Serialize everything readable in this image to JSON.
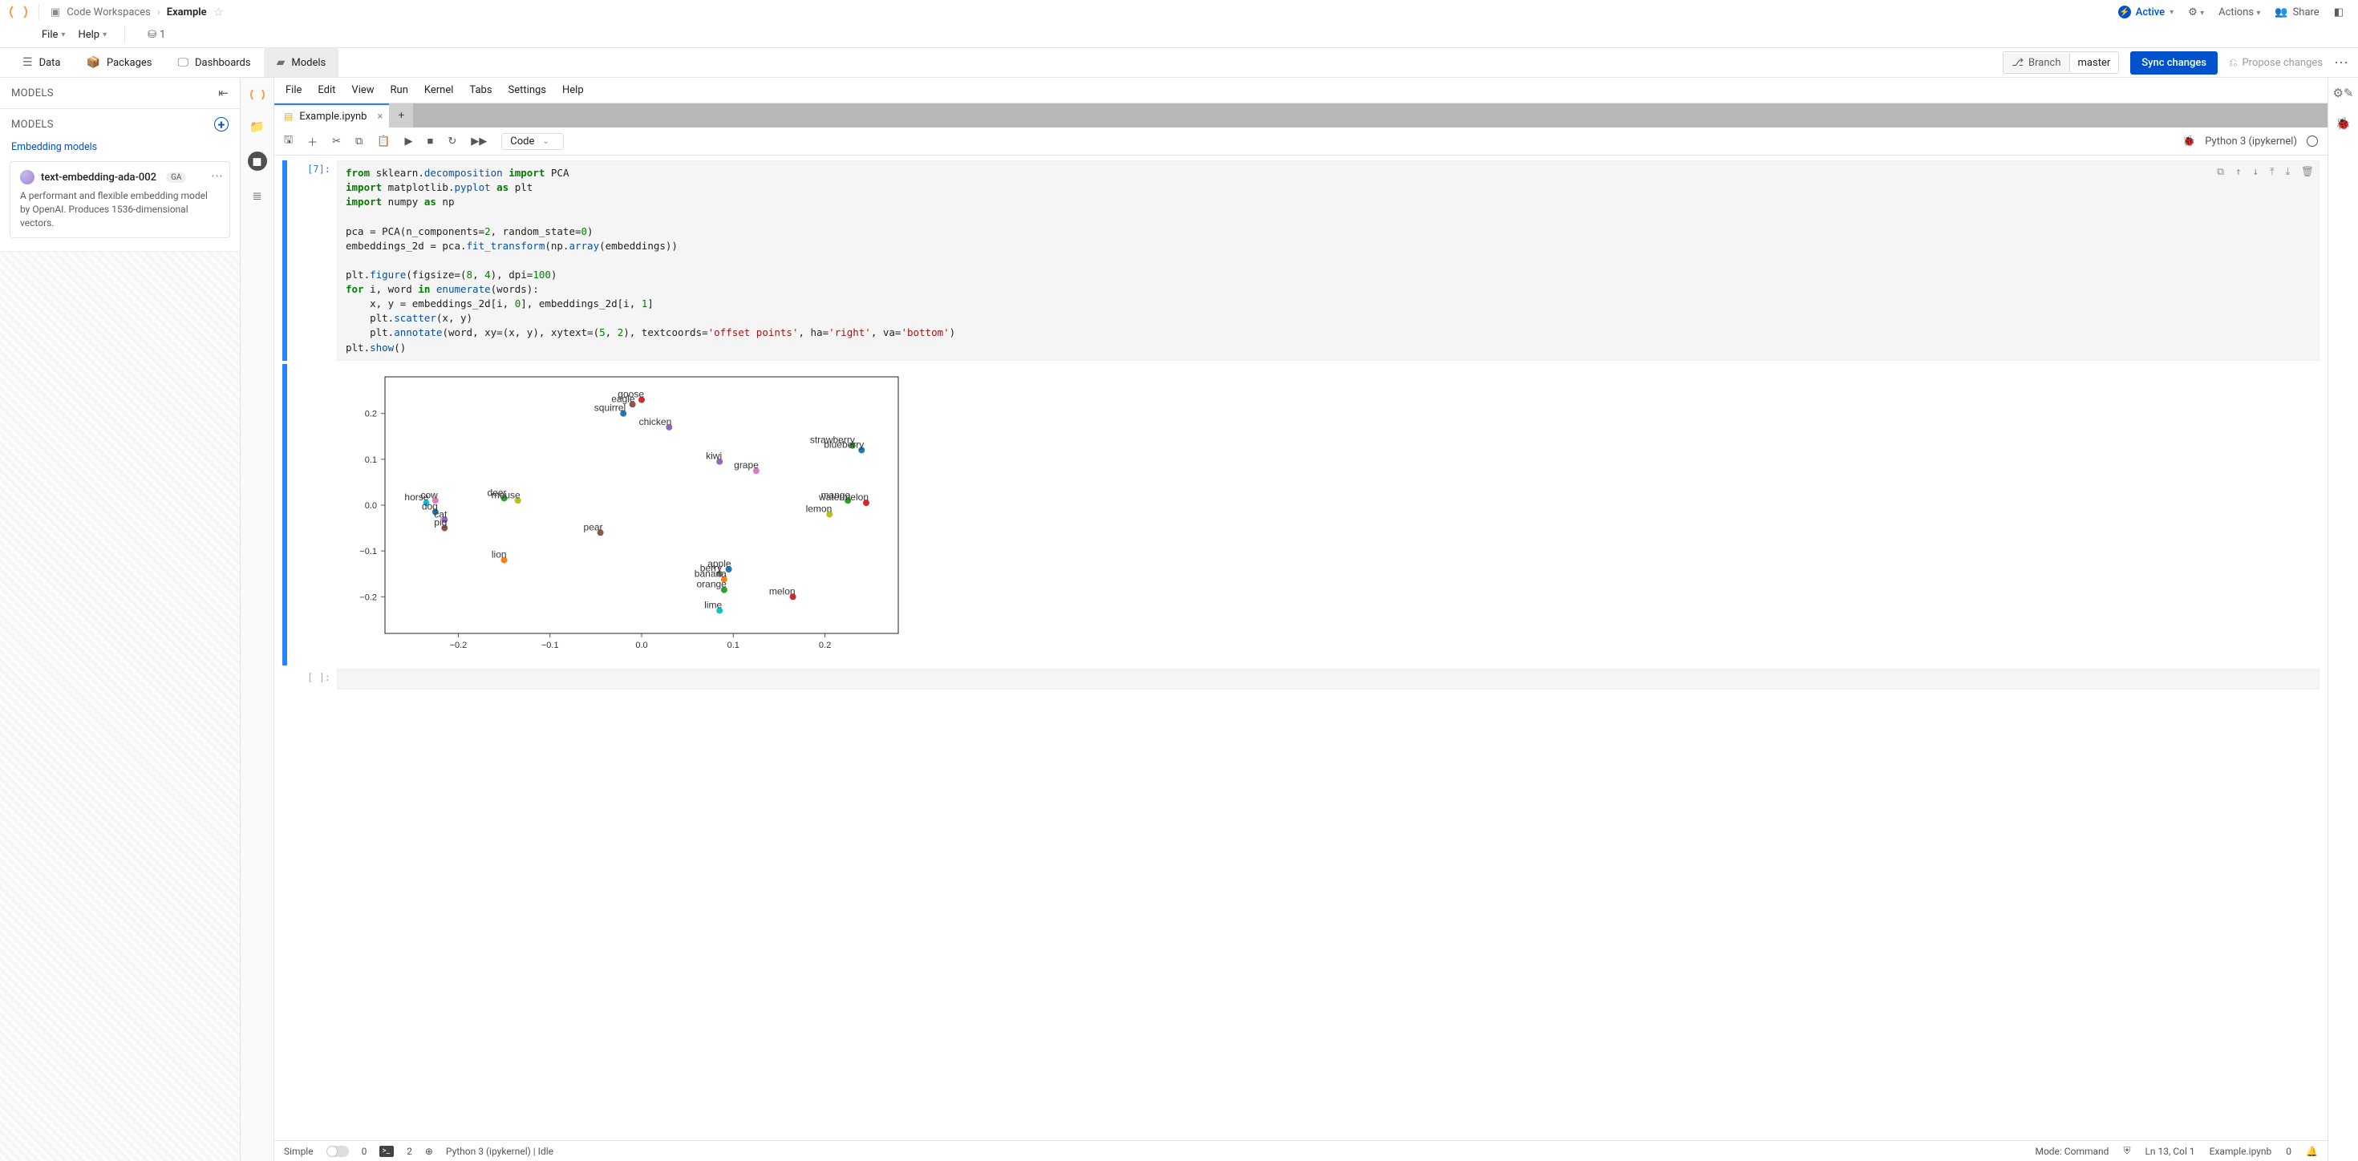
{
  "breadcrumbs": {
    "root": "Code Workspaces",
    "current": "Example"
  },
  "file_menu": {
    "file": "File",
    "help": "Help"
  },
  "resource_count": "1",
  "header_right": {
    "status": "Active",
    "actions": "Actions",
    "share": "Share"
  },
  "ctx_tabs": {
    "data": "Data",
    "packages": "Packages",
    "dashboards": "Dashboards",
    "models": "Models"
  },
  "branch": {
    "label": "Branch",
    "name": "master"
  },
  "buttons": {
    "sync": "Sync changes",
    "propose": "Propose changes"
  },
  "left_panel": {
    "title": "MODELS",
    "subtitle": "MODELS",
    "group": "Embedding models",
    "card": {
      "name": "text-embedding-ada-002",
      "badge": "GA",
      "desc": "A performant and flexible embedding model by OpenAI. Produces 1536-dimensional vectors."
    }
  },
  "nb_menus": {
    "file": "File",
    "edit": "Edit",
    "view": "View",
    "run": "Run",
    "kernel": "Kernel",
    "tabs": "Tabs",
    "settings": "Settings",
    "help": "Help"
  },
  "nb_tab": {
    "name": "Example.ipynb"
  },
  "toolbar": {
    "celltype": "Code",
    "kernel": "Python 3 (ipykernel)"
  },
  "cell": {
    "prompt": "[7]:",
    "empty_prompt": "[ ]:"
  },
  "statusbar": {
    "simple": "Simple",
    "n0": "0",
    "terms": "2",
    "kernel": "Python 3 (ipykernel) | Idle",
    "mode": "Mode: Command",
    "pos": "Ln 13, Col 1",
    "file": "Example.ipynb",
    "n1": "0"
  },
  "chart_data": {
    "type": "scatter",
    "title": "",
    "xlabel": "",
    "ylabel": "",
    "xlim": [
      -0.28,
      0.28
    ],
    "ylim": [
      -0.28,
      0.28
    ],
    "xticks": [
      -0.2,
      -0.1,
      0.0,
      0.1,
      0.2
    ],
    "yticks": [
      -0.2,
      -0.1,
      0.0,
      0.1,
      0.2
    ],
    "points": [
      {
        "label": "goose",
        "x": 0.0,
        "y": 0.23,
        "color": "#d62728"
      },
      {
        "label": "eagle",
        "x": -0.01,
        "y": 0.22,
        "color": "#8c564b"
      },
      {
        "label": "squirrel",
        "x": -0.02,
        "y": 0.2,
        "color": "#1f77b4"
      },
      {
        "label": "chicken",
        "x": 0.03,
        "y": 0.17,
        "color": "#9467bd"
      },
      {
        "label": "strawberry",
        "x": 0.23,
        "y": 0.13,
        "color": "#2ca02c"
      },
      {
        "label": "blueberry",
        "x": 0.24,
        "y": 0.12,
        "color": "#1f77b4"
      },
      {
        "label": "kiwi",
        "x": 0.085,
        "y": 0.095,
        "color": "#9467bd"
      },
      {
        "label": "grape",
        "x": 0.125,
        "y": 0.075,
        "color": "#e377c2"
      },
      {
        "label": "deer",
        "x": -0.15,
        "y": 0.015,
        "color": "#2ca02c"
      },
      {
        "label": "mouse",
        "x": -0.135,
        "y": 0.01,
        "color": "#bcbd22"
      },
      {
        "label": "cow",
        "x": -0.225,
        "y": 0.01,
        "color": "#e377c2"
      },
      {
        "label": "horse",
        "x": -0.235,
        "y": 0.005,
        "color": "#17becf"
      },
      {
        "label": "mango",
        "x": 0.225,
        "y": 0.01,
        "color": "#2ca02c"
      },
      {
        "label": "watermelon",
        "x": 0.245,
        "y": 0.005,
        "color": "#d62728"
      },
      {
        "label": "dog",
        "x": -0.225,
        "y": -0.015,
        "color": "#1f77b4"
      },
      {
        "label": "lemon",
        "x": 0.205,
        "y": -0.02,
        "color": "#bcbd22"
      },
      {
        "label": "cat",
        "x": -0.215,
        "y": -0.032,
        "color": "#9467bd"
      },
      {
        "label": "pig",
        "x": -0.215,
        "y": -0.05,
        "color": "#8c564b"
      },
      {
        "label": "pear",
        "x": -0.045,
        "y": -0.06,
        "color": "#8c564b"
      },
      {
        "label": "lion",
        "x": -0.15,
        "y": -0.12,
        "color": "#ff7f0e"
      },
      {
        "label": "apple",
        "x": 0.095,
        "y": -0.14,
        "color": "#1f77b4"
      },
      {
        "label": "berry",
        "x": 0.085,
        "y": -0.15,
        "color": "#7f7f7f"
      },
      {
        "label": "banana",
        "x": 0.09,
        "y": -0.162,
        "color": "#ff7f0e"
      },
      {
        "label": "orange",
        "x": 0.09,
        "y": -0.185,
        "color": "#2ca02c"
      },
      {
        "label": "melon",
        "x": 0.165,
        "y": -0.2,
        "color": "#d62728"
      },
      {
        "label": "lime",
        "x": 0.085,
        "y": -0.23,
        "color": "#17becf"
      }
    ]
  }
}
